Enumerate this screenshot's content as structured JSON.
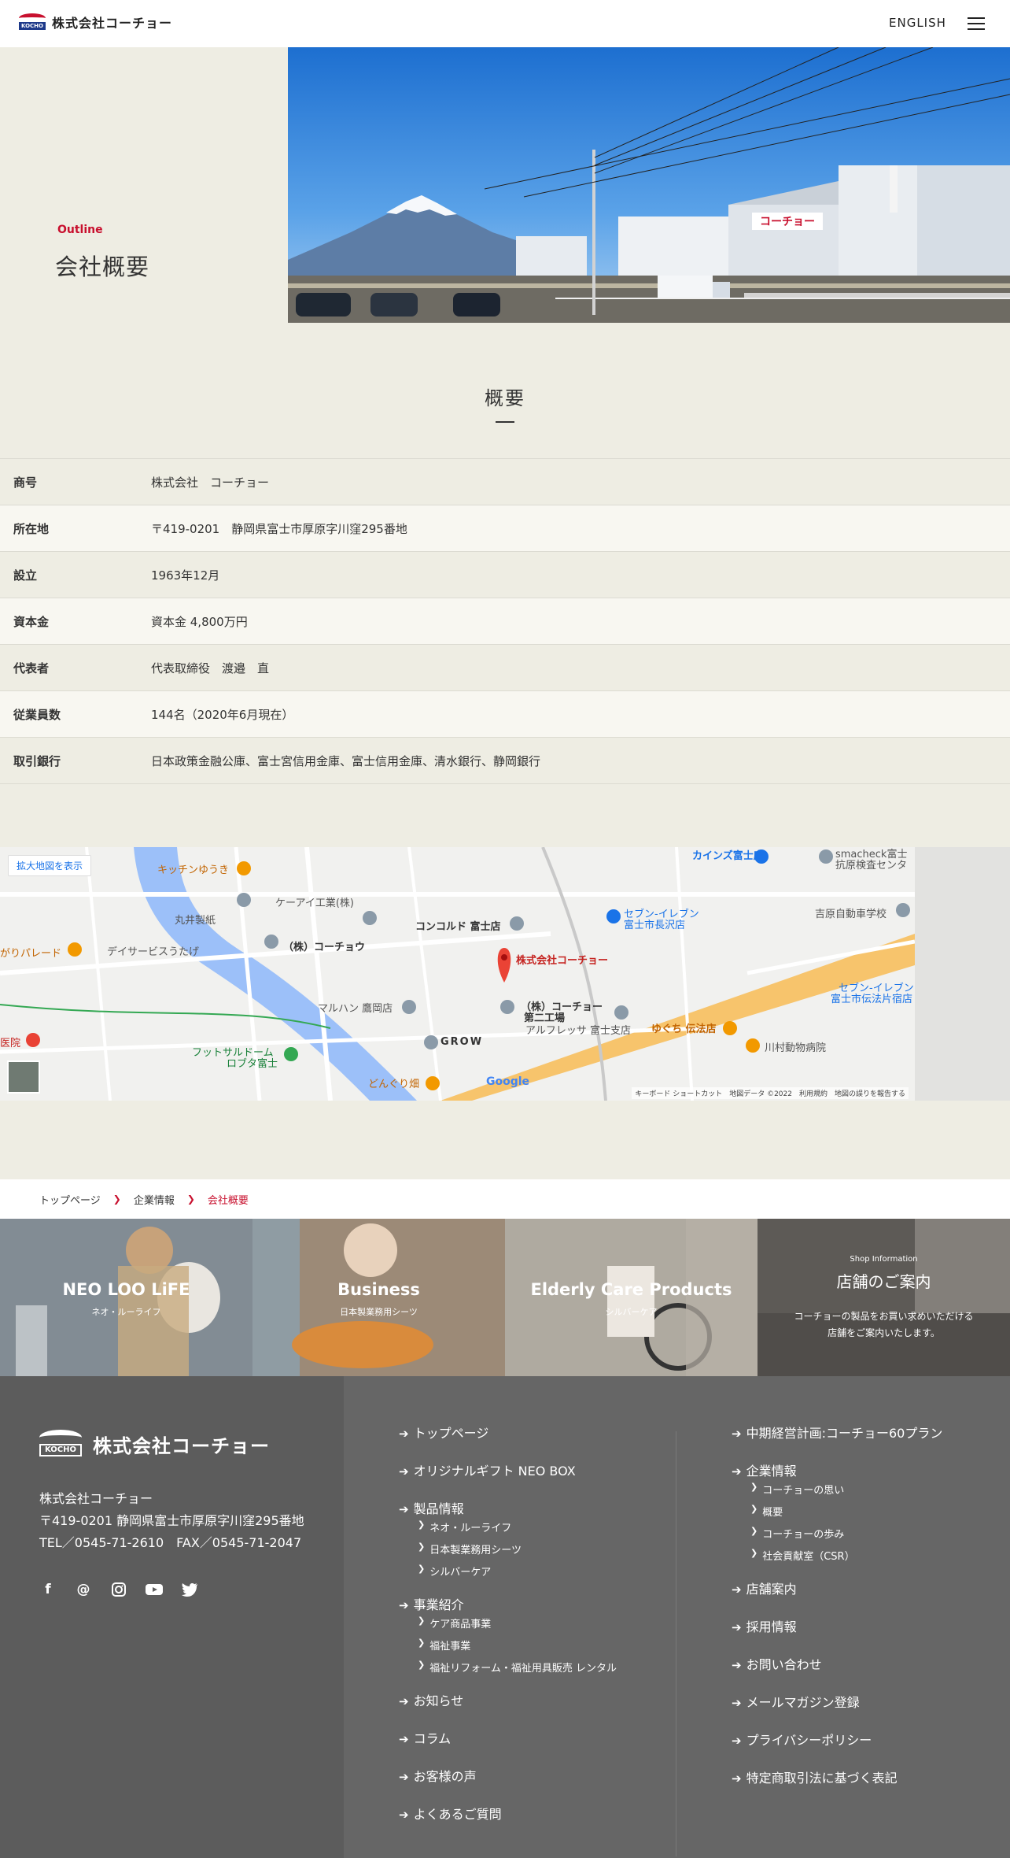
{
  "header": {
    "logo_badge": "KOCHO",
    "logo_text": "株式会社コーチョー",
    "lang_label": "ENGLISH"
  },
  "hero": {
    "eyebrow": "Outline",
    "title": "会社概要"
  },
  "outline": {
    "title": "概要",
    "rows": [
      {
        "label": "商号",
        "value": "株式会社　コーチョー"
      },
      {
        "label": "所在地",
        "value": "〒419-0201　静岡県富士市厚原字川窪295番地"
      },
      {
        "label": "設立",
        "value": "1963年12月"
      },
      {
        "label": "資本金",
        "value": "資本金 4,800万円"
      },
      {
        "label": "代表者",
        "value": "代表取締役　渡邉　直"
      },
      {
        "label": "従業員数",
        "value": "144名（2020年6月現在）"
      },
      {
        "label": "取引銀行",
        "value": "日本政策金融公庫、富士宮信用金庫、富士信用金庫、清水銀行、静岡銀行"
      }
    ]
  },
  "map": {
    "expand_label": "拡大地図を表示",
    "google": "Google",
    "attribution": "キーボード ショートカット　地図データ ©2022　利用規約　地図の誤りを報告する",
    "labels": {
      "kitchen": "キッチンゆうき",
      "cainz": "カインズ富士店",
      "smacheck": "smacheck富士",
      "kensa": "抗原検査センタ",
      "marui": "丸井製紙",
      "kei": "ケーアイ工業(株)",
      "kocho": "（株）コーチョウ",
      "concord": "コンコルド 富士店",
      "seven1": "セブン-イレブン",
      "seven1b": "富士市長沢店",
      "yoshiwara": "吉原自動車学校",
      "parade": "がりパレード",
      "dayservice": "デイサービスうたげ",
      "main_pin": "株式会社コーチョー",
      "seven2": "セブン-イレブン",
      "seven2b": "富士市伝法片宿店",
      "maruhan": "マルハン 鷹岡店",
      "factory": "（株）コーチョー",
      "factory2": "第二工場",
      "alfressa": "アルフレッサ 富士支店",
      "yuguchi": "ゆぐち 伝法店",
      "kawamura": "川村動物病院",
      "hospital": "医院",
      "futsal": "フットサルドーム",
      "futsal2": "ロブタ富士",
      "grow": "GROW",
      "donguri": "どんぐり畑"
    }
  },
  "breadcrumb": {
    "items": [
      "トップページ",
      "企業情報",
      "会社概要"
    ]
  },
  "banners": [
    {
      "title": "NEO LOO LiFE",
      "sub": "ネオ・ルーライフ"
    },
    {
      "title": "Business",
      "sub": "日本製業務用シーツ"
    },
    {
      "title": "Elderly Care Products",
      "sub": "シルバーケア"
    },
    {
      "small": "Shop Information",
      "title": "店舗のご案内",
      "desc1": "コーチョーの製品をお買い求めいただける",
      "desc2": "店舗をご案内いたします。"
    }
  ],
  "footer": {
    "badge": "KOCHO",
    "name": "株式会社コーチョー",
    "company": "株式会社コーチョー",
    "address": "〒419-0201 静岡県富士市厚原字川窪295番地",
    "tel": "TEL／0545-71-2610　FAX／0545-71-2047",
    "social_icons": [
      "facebook-icon",
      "mail-icon",
      "instagram-icon",
      "youtube-icon",
      "twitter-icon"
    ],
    "col1": {
      "top": "トップページ",
      "gift": "オリジナルギフト NEO BOX",
      "products": "製品情報",
      "products_sub": [
        "ネオ・ルーライフ",
        "日本製業務用シーツ",
        "シルバーケア"
      ],
      "business": "事業紹介",
      "business_sub": [
        "ケア商品事業",
        "福祉事業",
        "福祉リフォーム・福祉用具販売 レンタル"
      ],
      "news": "お知らせ",
      "column": "コラム",
      "voice": "お客様の声",
      "faq": "よくあるご質問"
    },
    "col2": {
      "plan": "中期経営計画:コーチョー60プラン",
      "company": "企業情報",
      "company_sub": [
        "コーチョーの思い",
        "概要",
        "コーチョーの歩み",
        "社会貢献室（CSR）"
      ],
      "shops": "店舗案内",
      "recruit": "採用情報",
      "contact": "お問い合わせ",
      "mail": "メールマガジン登録",
      "privacy": "プライバシーポリシー",
      "law": "特定商取引法に基づく表記"
    }
  },
  "colors": {
    "accent": "#c8102e",
    "beige": "#eeede3",
    "footer": "#5c5c5c"
  }
}
